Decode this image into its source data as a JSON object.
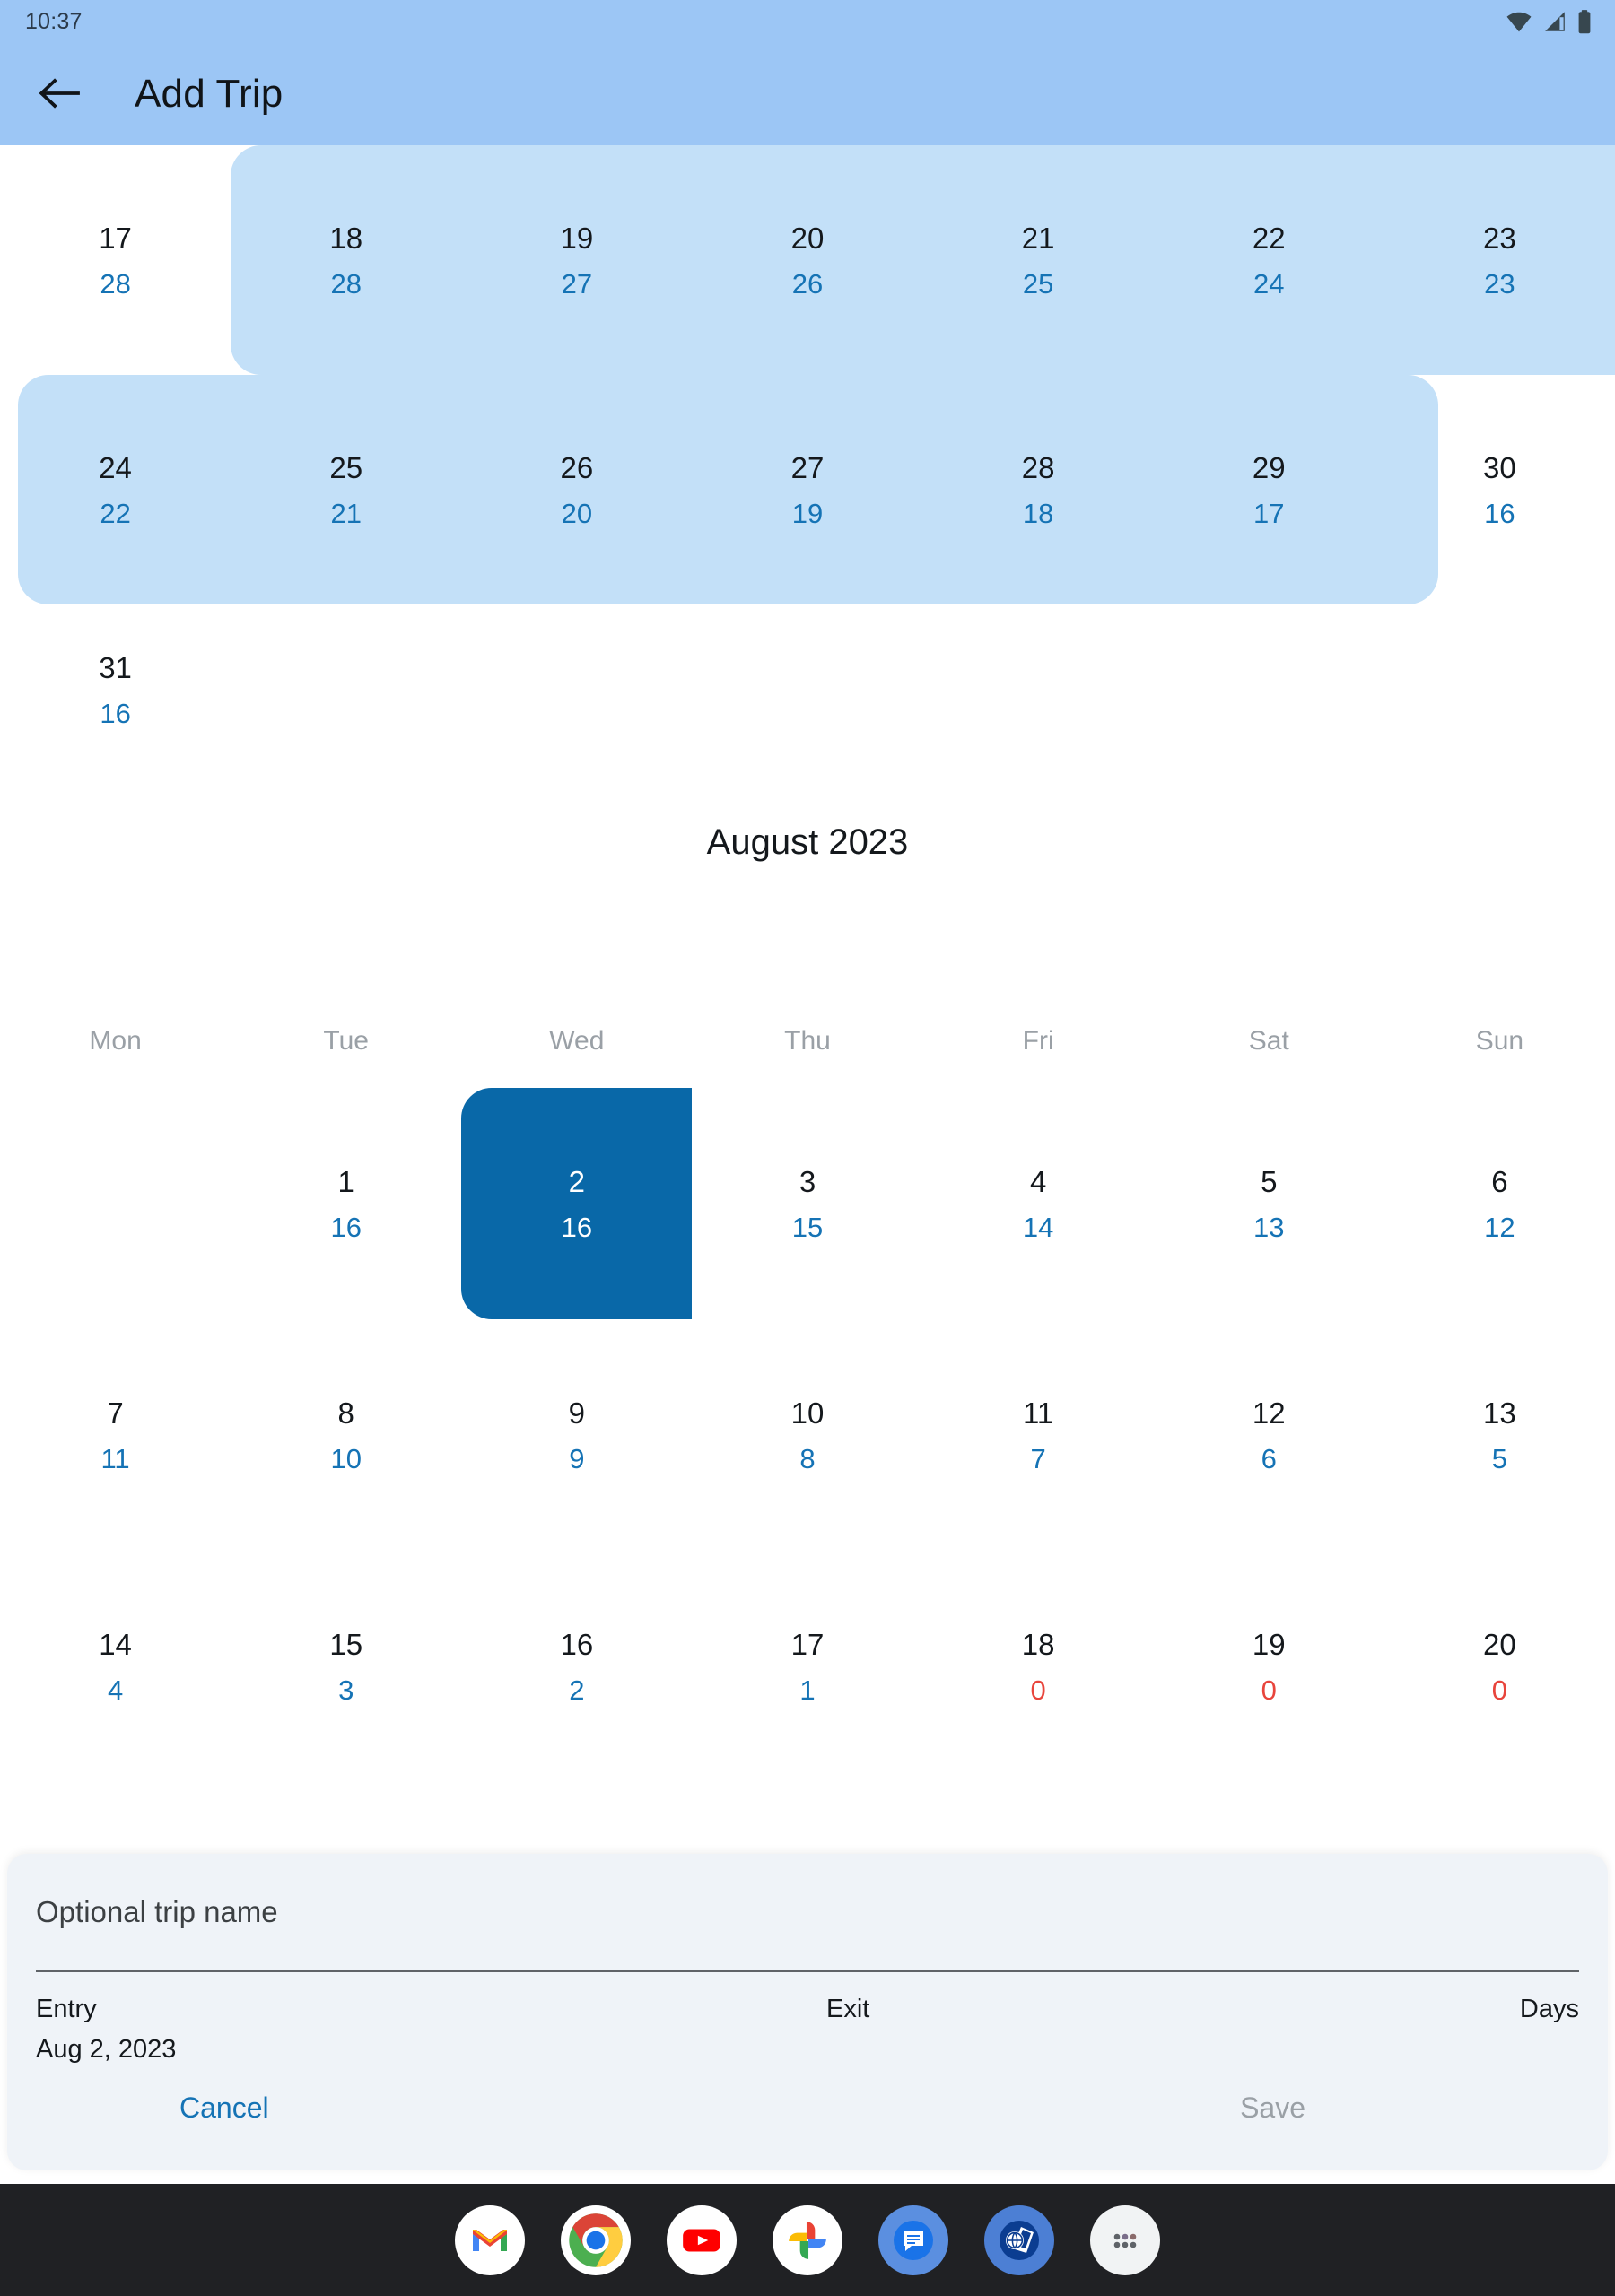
{
  "status_bar": {
    "time": "10:37",
    "icons": [
      "wifi-icon",
      "cell-signal-icon",
      "battery-icon"
    ]
  },
  "app_bar": {
    "back_icon": "back-arrow-icon",
    "title": "Add Trip"
  },
  "calendar": {
    "month_title": "August 2023",
    "weekdays": [
      "Mon",
      "Tue",
      "Wed",
      "Thu",
      "Fri",
      "Sat",
      "Sun"
    ],
    "prev_month_weeks": [
      {
        "days": [
          {
            "num": "17",
            "count": "28",
            "in_range": false
          },
          {
            "num": "18",
            "count": "28",
            "in_range": true
          },
          {
            "num": "19",
            "count": "27",
            "in_range": true
          },
          {
            "num": "20",
            "count": "26",
            "in_range": true
          },
          {
            "num": "21",
            "count": "25",
            "in_range": true
          },
          {
            "num": "22",
            "count": "24",
            "in_range": true
          },
          {
            "num": "23",
            "count": "23",
            "in_range": true
          }
        ]
      },
      {
        "days": [
          {
            "num": "24",
            "count": "22",
            "in_range": true
          },
          {
            "num": "25",
            "count": "21",
            "in_range": true
          },
          {
            "num": "26",
            "count": "20",
            "in_range": true
          },
          {
            "num": "27",
            "count": "19",
            "in_range": true
          },
          {
            "num": "28",
            "count": "18",
            "in_range": true
          },
          {
            "num": "29",
            "count": "17",
            "in_range": true
          },
          {
            "num": "30",
            "count": "16",
            "in_range": false
          }
        ]
      },
      {
        "days": [
          {
            "num": "31",
            "count": "16",
            "in_range": false
          },
          {
            "num": "",
            "count": "",
            "in_range": false
          },
          {
            "num": "",
            "count": "",
            "in_range": false
          },
          {
            "num": "",
            "count": "",
            "in_range": false
          },
          {
            "num": "",
            "count": "",
            "in_range": false
          },
          {
            "num": "",
            "count": "",
            "in_range": false
          },
          {
            "num": "",
            "count": "",
            "in_range": false
          }
        ]
      }
    ],
    "august_weeks": [
      {
        "days": [
          {
            "num": "",
            "count": "",
            "selected": false
          },
          {
            "num": "1",
            "count": "16",
            "selected": false
          },
          {
            "num": "2",
            "count": "16",
            "selected": true
          },
          {
            "num": "3",
            "count": "15",
            "selected": false
          },
          {
            "num": "4",
            "count": "14",
            "selected": false
          },
          {
            "num": "5",
            "count": "13",
            "selected": false
          },
          {
            "num": "6",
            "count": "12",
            "selected": false
          }
        ]
      },
      {
        "days": [
          {
            "num": "7",
            "count": "11",
            "selected": false
          },
          {
            "num": "8",
            "count": "10",
            "selected": false
          },
          {
            "num": "9",
            "count": "9",
            "selected": false
          },
          {
            "num": "10",
            "count": "8",
            "selected": false
          },
          {
            "num": "11",
            "count": "7",
            "selected": false
          },
          {
            "num": "12",
            "count": "6",
            "selected": false
          },
          {
            "num": "13",
            "count": "5",
            "selected": false
          }
        ]
      },
      {
        "days": [
          {
            "num": "14",
            "count": "4",
            "selected": false
          },
          {
            "num": "15",
            "count": "3",
            "selected": false
          },
          {
            "num": "16",
            "count": "2",
            "selected": false
          },
          {
            "num": "17",
            "count": "1",
            "selected": false
          },
          {
            "num": "18",
            "count": "0",
            "selected": false,
            "zero": true
          },
          {
            "num": "19",
            "count": "0",
            "selected": false,
            "zero": true
          },
          {
            "num": "20",
            "count": "0",
            "selected": false,
            "zero": true
          }
        ]
      }
    ]
  },
  "sheet": {
    "trip_name_placeholder": "Optional trip name",
    "trip_name_value": "",
    "entry_label": "Entry",
    "entry_value": "Aug 2, 2023",
    "exit_label": "Exit",
    "exit_value": "",
    "days_label": "Days",
    "days_value": "",
    "cancel_label": "Cancel",
    "save_label": "Save"
  },
  "dock": {
    "items": [
      {
        "name": "gmail-icon"
      },
      {
        "name": "chrome-icon"
      },
      {
        "name": "youtube-icon"
      },
      {
        "name": "google-photos-icon"
      },
      {
        "name": "messages-icon"
      },
      {
        "name": "travel-passport-icon"
      },
      {
        "name": "app-drawer-icon"
      }
    ]
  },
  "colors": {
    "appbar": "#9CC6F5",
    "range_band": "#C3E0F8",
    "selected": "#0968A8",
    "accent_blue": "#1573B5",
    "zero_red": "#E8453C",
    "sheet_bg": "#EFF3F8"
  }
}
